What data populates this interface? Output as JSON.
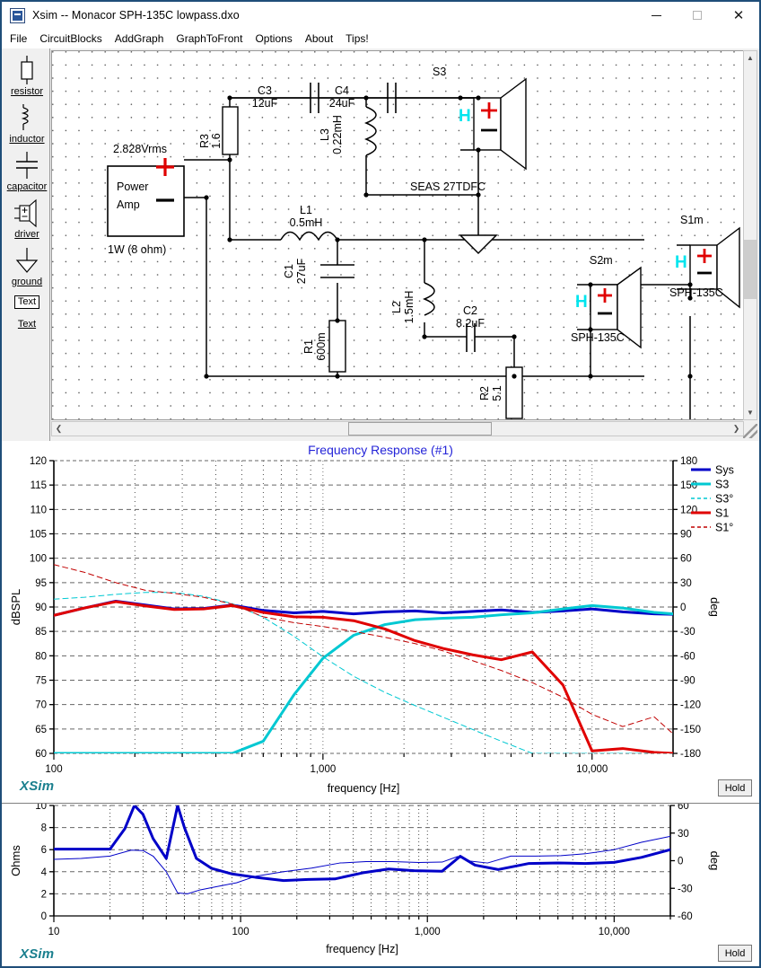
{
  "window": {
    "title": "Xsim -- Monacor SPH-135C lowpass.dxo",
    "app_icon": "xsim-app-icon",
    "minimize": "—",
    "maximize": "□",
    "close": "✕"
  },
  "menu": {
    "items": [
      {
        "label": "File"
      },
      {
        "label": "CircuitBlocks"
      },
      {
        "label": "AddGraph"
      },
      {
        "label": "GraphToFront"
      },
      {
        "label": "Options"
      },
      {
        "label": "About"
      },
      {
        "label": "Tips!"
      }
    ]
  },
  "toolbar": {
    "items": [
      {
        "label": "resistor",
        "icon": "resistor-icon"
      },
      {
        "label": "inductor",
        "icon": "inductor-icon"
      },
      {
        "label": "capacitor",
        "icon": "capacitor-icon"
      },
      {
        "label": "driver",
        "icon": "driver-icon"
      },
      {
        "label": "ground",
        "icon": "ground-icon"
      },
      {
        "label": "Text",
        "icon": "text-box-icon"
      },
      {
        "label": "Text",
        "icon": "text-label-icon"
      }
    ]
  },
  "schematic": {
    "source": {
      "label_top": "2.828Vrms",
      "name_line1": "Power",
      "name_line2": "Amp",
      "label_bottom": "1W (8 ohm)",
      "plus": "+",
      "minus": "−"
    },
    "components": [
      {
        "ref": "R3",
        "value": "1.6",
        "type": "resistor"
      },
      {
        "ref": "C3",
        "value": "12uF",
        "type": "capacitor"
      },
      {
        "ref": "C4",
        "value": "24uF",
        "type": "capacitor"
      },
      {
        "ref": "L3",
        "value": "0.22mH",
        "type": "inductor"
      },
      {
        "ref": "L1",
        "value": "0.5mH",
        "type": "inductor"
      },
      {
        "ref": "C1",
        "value": "27uF",
        "type": "capacitor"
      },
      {
        "ref": "R1",
        "value": "600m",
        "type": "resistor"
      },
      {
        "ref": "L2",
        "value": "1.5mH",
        "type": "inductor"
      },
      {
        "ref": "C2",
        "value": "8.2uF",
        "type": "capacitor"
      },
      {
        "ref": "R2",
        "value": "5.1",
        "type": "resistor"
      }
    ],
    "drivers": [
      {
        "ref": "S3",
        "model": "SEAS 27TDFC",
        "marker": "H"
      },
      {
        "ref": "S1m",
        "model": "SPH-135C",
        "marker": "H"
      },
      {
        "ref": "S2m",
        "model": "SPH-135C",
        "marker": "H"
      }
    ]
  },
  "graph1": {
    "title": "Frequency Response (#1)",
    "logo": "XSim",
    "hold_label": "Hold",
    "chart_data": {
      "type": "line",
      "title": "Frequency Response (#1)",
      "xlabel": "frequency [Hz]",
      "ylabel": "dBSPL",
      "y2label": "deg",
      "xscale": "log",
      "xlim": [
        100,
        20000
      ],
      "ylim": [
        60,
        120
      ],
      "y2lim": [
        -180,
        180
      ],
      "grid": true,
      "legend_position": "top-right",
      "xticks": [
        100,
        1000,
        10000
      ],
      "xticklabels": [
        "100",
        "1,000",
        "10,000"
      ],
      "yticks": [
        60,
        65,
        70,
        75,
        80,
        85,
        90,
        95,
        100,
        105,
        110,
        115,
        120
      ],
      "y2ticks": [
        -180,
        -150,
        -120,
        -90,
        -60,
        -30,
        0,
        30,
        60,
        90,
        120,
        150,
        180
      ],
      "series": [
        {
          "name": "Sys",
          "color": "#0000c8",
          "style": "solid",
          "width": 3,
          "axis": "left",
          "x": [
            100,
            130,
            170,
            220,
            280,
            360,
            460,
            600,
            780,
            1000,
            1300,
            1700,
            2200,
            2800,
            3600,
            4600,
            6000,
            7800,
            10000,
            13000,
            17000,
            20000
          ],
          "y": [
            88.3,
            89.8,
            91.2,
            90.4,
            89.6,
            89.7,
            90.4,
            89.3,
            88.8,
            89.1,
            88.6,
            89.0,
            89.2,
            88.8,
            89.1,
            89.4,
            88.9,
            89.2,
            89.6,
            89.0,
            88.6,
            88.5
          ]
        },
        {
          "name": "S3",
          "color": "#00c8d2",
          "style": "solid",
          "width": 3,
          "axis": "left",
          "x": [
            100,
            130,
            170,
            220,
            280,
            360,
            460,
            600,
            780,
            1000,
            1300,
            1700,
            2200,
            2800,
            3600,
            4600,
            6000,
            7800,
            10000,
            13000,
            17000,
            20000
          ],
          "y": [
            60.0,
            60.0,
            60.0,
            60.0,
            60.0,
            60.0,
            60.0,
            62.5,
            72.0,
            79.5,
            84.2,
            86.4,
            87.4,
            87.7,
            87.9,
            88.4,
            88.8,
            89.6,
            90.3,
            89.8,
            88.9,
            88.6
          ]
        },
        {
          "name": "S3°",
          "color": "#00c8d2",
          "style": "dashed",
          "width": 1,
          "axis": "left",
          "x": [
            100,
            130,
            170,
            220,
            280,
            360,
            460,
            600,
            780,
            1000,
            1300,
            1700,
            2200,
            2800,
            3600,
            4600,
            6000,
            7800,
            10000,
            13000,
            17000,
            20000
          ],
          "y": [
            91.6,
            92.0,
            92.6,
            93.0,
            93.0,
            92.2,
            90.7,
            87.9,
            84.0,
            79.8,
            75.8,
            72.5,
            69.8,
            67.4,
            64.9,
            62.5,
            60.0,
            60.0,
            60.0,
            60.0,
            60.0,
            60.0
          ]
        },
        {
          "name": "S1",
          "color": "#e00000",
          "style": "solid",
          "width": 3,
          "axis": "left",
          "x": [
            100,
            130,
            170,
            220,
            280,
            360,
            460,
            600,
            780,
            1000,
            1300,
            1700,
            2200,
            2800,
            3600,
            4600,
            6000,
            7800,
            10000,
            13000,
            17000,
            20000
          ],
          "y": [
            88.3,
            89.8,
            91.1,
            90.2,
            89.5,
            89.6,
            90.3,
            88.9,
            88.0,
            87.9,
            87.2,
            85.5,
            83.1,
            81.5,
            80.2,
            79.2,
            80.8,
            74.0,
            60.5,
            61.0,
            60.2,
            60.0
          ]
        },
        {
          "name": "S1°",
          "color": "#c00000",
          "style": "dashed",
          "width": 1,
          "axis": "left",
          "x": [
            100,
            130,
            170,
            220,
            280,
            360,
            460,
            600,
            780,
            1000,
            1300,
            1700,
            2200,
            2800,
            3600,
            4600,
            6000,
            7800,
            10000,
            13000,
            17000,
            20000
          ],
          "y": [
            98.7,
            97.1,
            95.0,
            93.4,
            92.8,
            92.0,
            90.6,
            88.0,
            86.8,
            86.0,
            85.0,
            83.8,
            82.5,
            81.0,
            79.0,
            77.0,
            74.5,
            71.5,
            68.0,
            65.5,
            67.5,
            64.0
          ]
        }
      ],
      "legend": [
        {
          "label": "Sys",
          "color": "#0000c8",
          "style": "solid"
        },
        {
          "label": "S3",
          "color": "#00c8d2",
          "style": "solid"
        },
        {
          "label": "S3°",
          "color": "#00c8d2",
          "style": "dashed"
        },
        {
          "label": "S1",
          "color": "#e00000",
          "style": "solid"
        },
        {
          "label": "S1°",
          "color": "#c00000",
          "style": "dashed"
        }
      ]
    }
  },
  "graph2": {
    "logo": "XSim",
    "hold_label": "Hold",
    "chart_data": {
      "type": "line",
      "xlabel": "frequency [Hz]",
      "ylabel": "Ohms",
      "y2label": "deg",
      "xscale": "log",
      "xlim": [
        10,
        20000
      ],
      "ylim": [
        0,
        10
      ],
      "y2lim": [
        -60,
        60
      ],
      "grid": true,
      "xticks": [
        10,
        100,
        1000,
        10000
      ],
      "xticklabels": [
        "10",
        "100",
        "1,000",
        "10,000"
      ],
      "yticks": [
        0,
        2,
        4,
        6,
        8,
        10
      ],
      "y2ticks": [
        -60,
        -30,
        0,
        30,
        60
      ],
      "series": [
        {
          "name": "impedance-magnitude",
          "color": "#0000c8",
          "style": "solid",
          "width": 3,
          "axis": "left",
          "x": [
            10,
            14,
            20,
            24,
            27,
            30,
            34,
            40,
            46,
            50,
            58,
            70,
            90,
            120,
            170,
            230,
            320,
            450,
            620,
            850,
            1200,
            1500,
            1800,
            2400,
            3500,
            5000,
            7000,
            10000,
            14000,
            20000
          ],
          "y": [
            6.05,
            6.05,
            6.05,
            7.9,
            10.0,
            9.2,
            7.0,
            5.2,
            10.0,
            8.0,
            5.2,
            4.3,
            3.8,
            3.5,
            3.2,
            3.3,
            3.35,
            3.9,
            4.25,
            4.1,
            4.05,
            5.4,
            4.6,
            4.2,
            4.75,
            4.8,
            4.75,
            4.85,
            5.3,
            6.0
          ]
        },
        {
          "name": "impedance-phase",
          "color": "#0000c8",
          "style": "solid",
          "width": 1,
          "axis": "right",
          "x": [
            10,
            14,
            20,
            26,
            30,
            34,
            40,
            46,
            52,
            60,
            75,
            95,
            120,
            170,
            240,
            340,
            470,
            650,
            900,
            1200,
            1450,
            1700,
            2100,
            2800,
            3800,
            5200,
            7000,
            10000,
            14000,
            20000
          ],
          "y": [
            1.5,
            2.5,
            5.0,
            11.5,
            11.0,
            5.0,
            -12.0,
            -35.0,
            -36.0,
            -32.0,
            -28.0,
            -24.0,
            -17.0,
            -12.0,
            -8.0,
            -2.5,
            -1.0,
            -1.0,
            -2.0,
            -1.5,
            4.5,
            -0.5,
            -2.5,
            5.0,
            5.0,
            5.5,
            7.5,
            12.0,
            20.0,
            26.5
          ]
        }
      ]
    }
  }
}
